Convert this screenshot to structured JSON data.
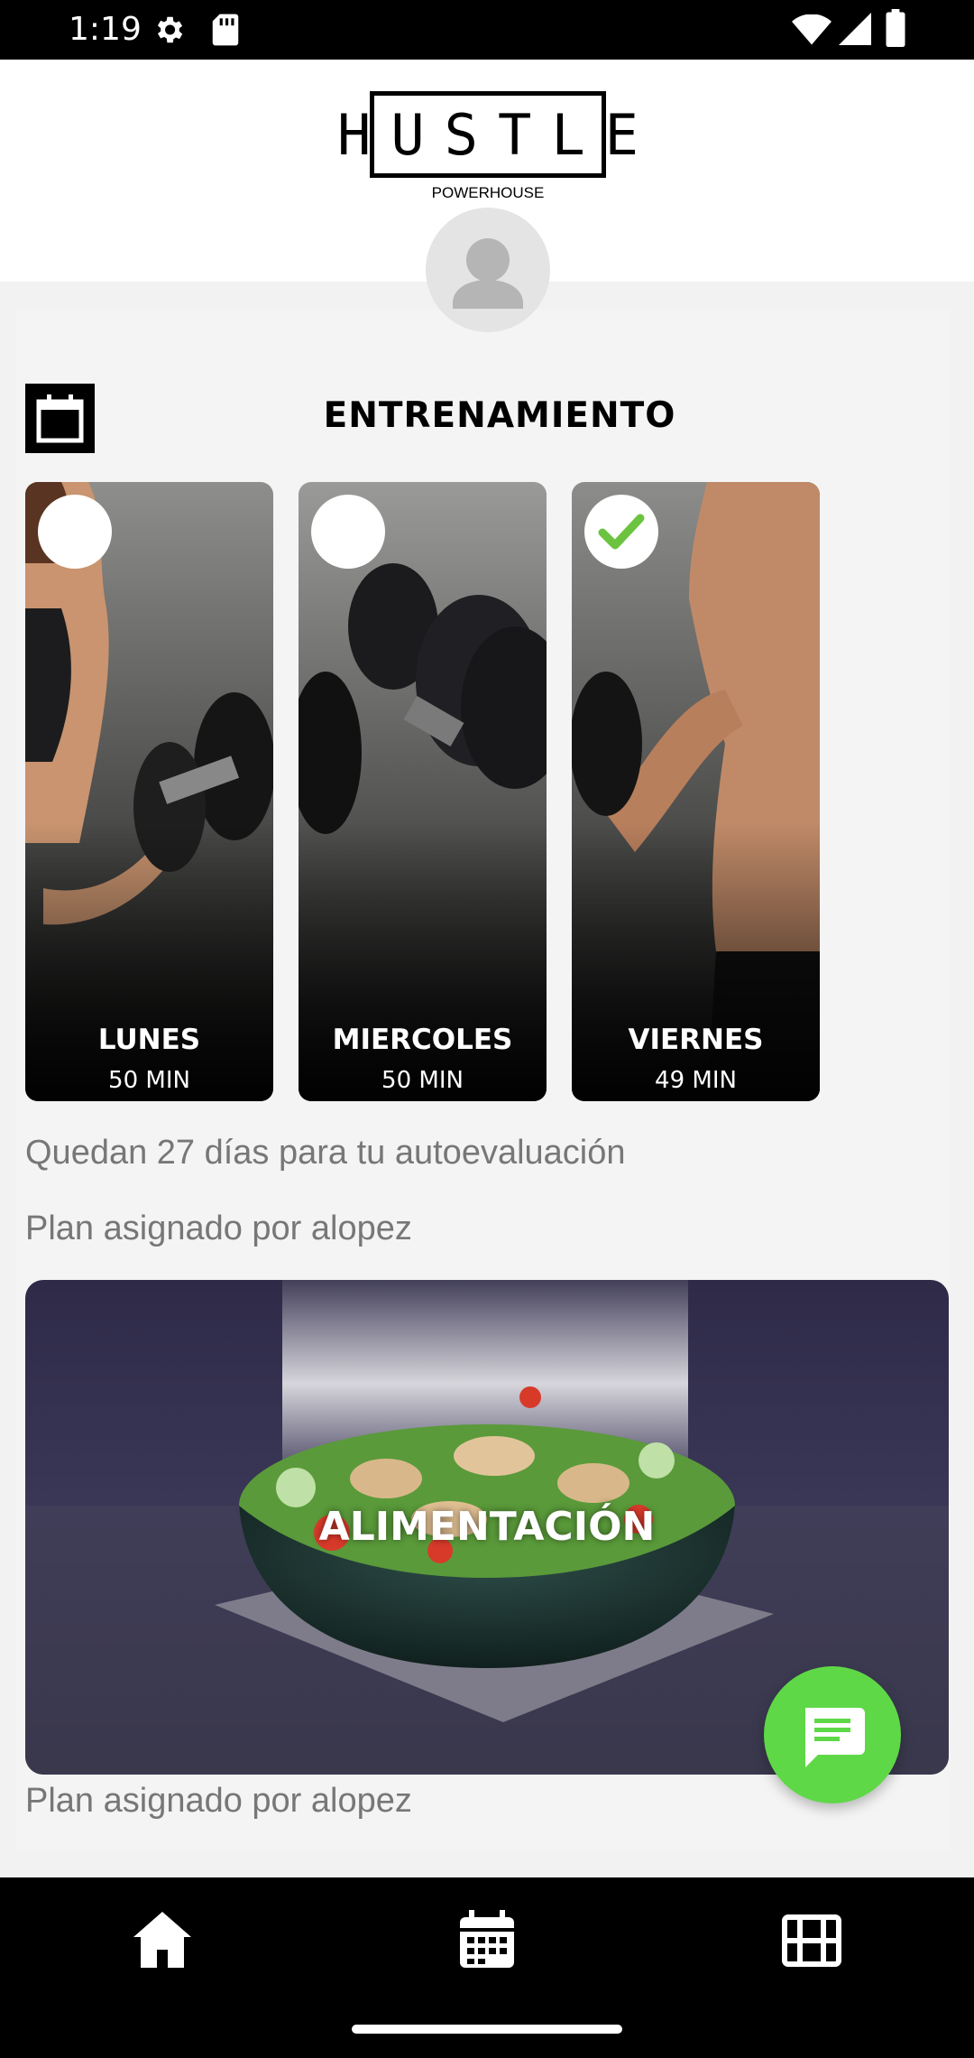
{
  "status_bar": {
    "time": "1:19"
  },
  "header": {
    "logo_main": "HUSTLE",
    "logo_sub": "POWERHOUSE"
  },
  "section": {
    "title": "ENTRENAMIENTO"
  },
  "workouts": [
    {
      "day": "LUNES",
      "duration": "50 MIN",
      "completed": false
    },
    {
      "day": "MIERCOLES",
      "duration": "50 MIN",
      "completed": false
    },
    {
      "day": "VIERNES",
      "duration": "49 MIN",
      "completed": true
    }
  ],
  "info": {
    "evaluation": "Quedan 27 días para tu autoevaluación",
    "assigned_training": "Plan asignado por alopez",
    "assigned_food": "Plan asignado por alopez"
  },
  "food_card": {
    "title": "ALIMENTACIÓN"
  },
  "colors": {
    "accent_green": "#5fd848",
    "check_green": "#6bc33f",
    "nav_bg": "#000000"
  },
  "nav": {
    "items": [
      "home-icon",
      "calendar-icon",
      "film-icon"
    ]
  }
}
